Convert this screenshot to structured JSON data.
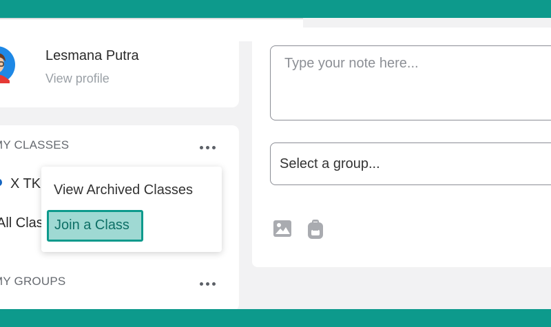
{
  "profile": {
    "name": "Lesmana Putra",
    "link": "View profile"
  },
  "classes": {
    "title": "MY CLASSES",
    "items": [
      {
        "name": "X TK"
      }
    ],
    "all_label": "All Clas"
  },
  "class_menu": {
    "items": [
      {
        "label": "View Archived Classes"
      },
      {
        "label": "Join a Class"
      }
    ]
  },
  "groups": {
    "title": "MY GROUPS"
  },
  "composer": {
    "note_placeholder": "Type your note here...",
    "group_select": "Select a group...",
    "attachments": [
      {
        "icon": "image-icon"
      },
      {
        "icon": "backpack-icon"
      }
    ]
  },
  "colors": {
    "accent": "#0d9a8c",
    "highlight": "#9fd9d3"
  }
}
